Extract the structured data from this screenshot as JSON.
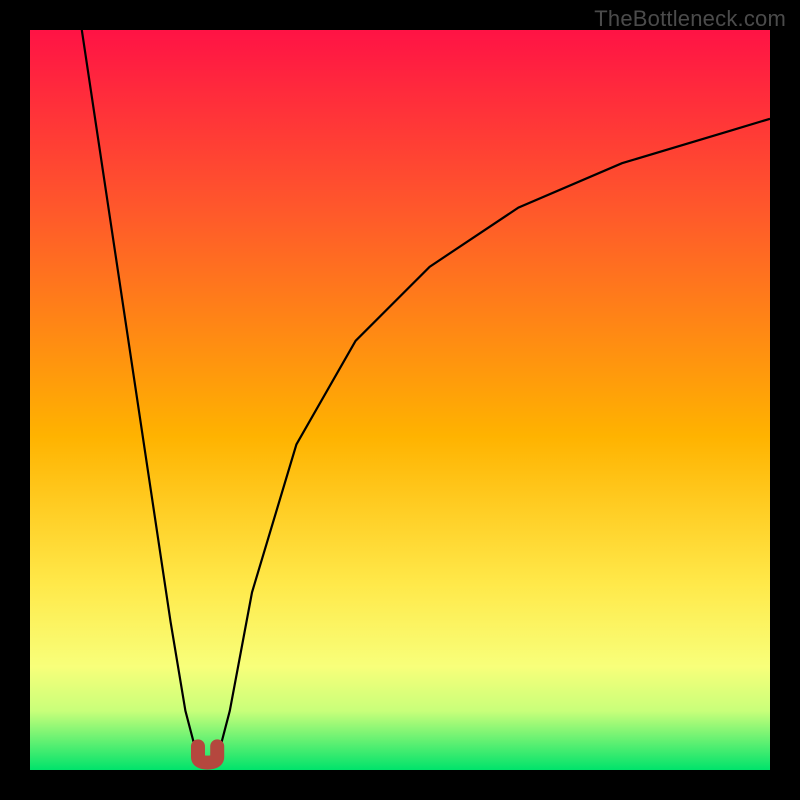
{
  "watermark": "TheBottleneck.com",
  "chart_data": {
    "type": "line",
    "title": "",
    "xlabel": "",
    "ylabel": "",
    "xlim": [
      0,
      100
    ],
    "ylim": [
      0,
      100
    ],
    "gradient_colors": [
      "#ff1345",
      "#ff5a2a",
      "#ffb300",
      "#ffe94a",
      "#f8ff7a",
      "#c9ff7a",
      "#00e36b"
    ],
    "gradient_stops": [
      0,
      0.25,
      0.55,
      0.75,
      0.86,
      0.92,
      1.0
    ],
    "series": [
      {
        "name": "left-branch",
        "x": [
          7,
          10,
          13,
          16,
          19,
          21,
          22.7
        ],
        "y": [
          100,
          80,
          60,
          40,
          20,
          8,
          1.5
        ]
      },
      {
        "name": "right-branch",
        "x": [
          25.3,
          27,
          30,
          36,
          44,
          54,
          66,
          80,
          95,
          100
        ],
        "y": [
          1.5,
          8,
          24,
          44,
          58,
          68,
          76,
          82,
          86.5,
          88
        ]
      }
    ],
    "marker": {
      "name": "valley-u-marker",
      "x_left": 22.7,
      "x_right": 25.3,
      "y_top": 3.2,
      "y_bottom": 1.0
    }
  }
}
